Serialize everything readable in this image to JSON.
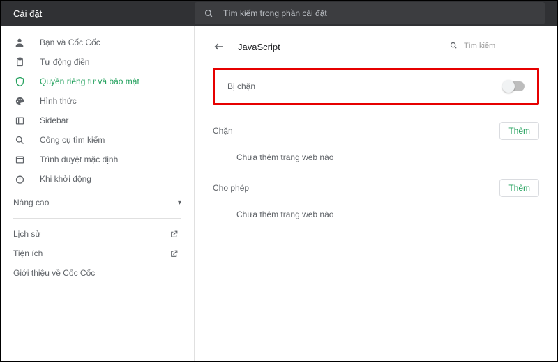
{
  "header": {
    "title": "Cài đặt",
    "search_placeholder": "Tìm kiếm trong phần cài đặt"
  },
  "sidebar": {
    "items": [
      {
        "label": "Bạn và Cốc Cốc"
      },
      {
        "label": "Tự động điền"
      },
      {
        "label": "Quyền riêng tư và bảo mật"
      },
      {
        "label": "Hình thức"
      },
      {
        "label": "Sidebar"
      },
      {
        "label": "Công cụ tìm kiếm"
      },
      {
        "label": "Trình duyệt mặc định"
      },
      {
        "label": "Khi khởi động"
      }
    ],
    "advanced_label": "Nâng cao",
    "links": [
      {
        "label": "Lịch sử"
      },
      {
        "label": "Tiện ích"
      },
      {
        "label": "Giới thiệu về Cốc Cốc"
      }
    ]
  },
  "main": {
    "page_title": "JavaScript",
    "search_placeholder": "Tìm kiếm",
    "blocked_label": "Bị chặn",
    "sections": [
      {
        "title": "Chặn",
        "add_label": "Thêm",
        "empty_text": "Chưa thêm trang web nào"
      },
      {
        "title": "Cho phép",
        "add_label": "Thêm",
        "empty_text": "Chưa thêm trang web nào"
      }
    ]
  }
}
